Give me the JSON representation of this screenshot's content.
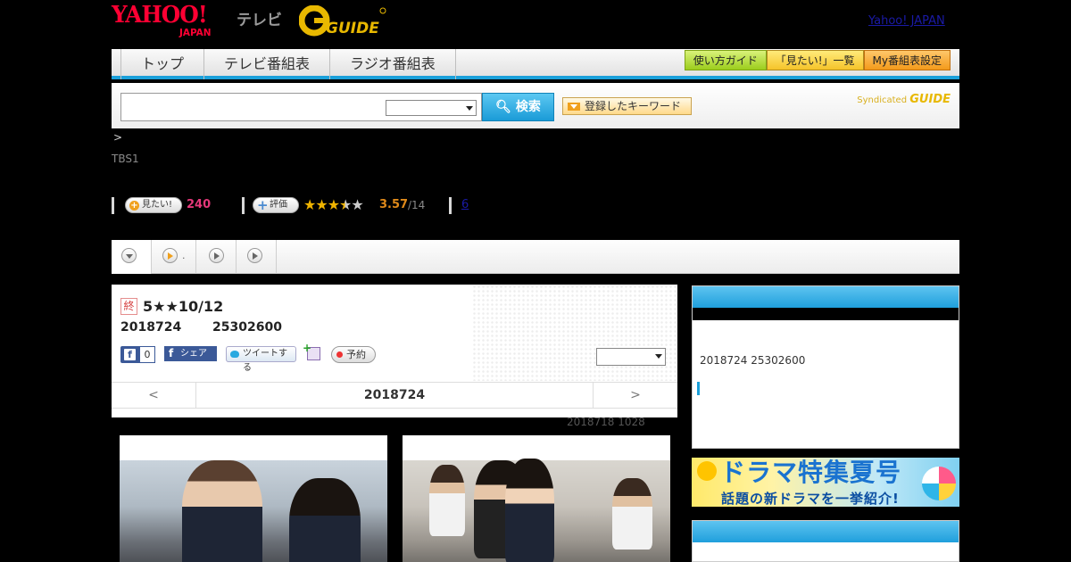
{
  "header": {
    "yahoo_logo": "YAHOO!",
    "yahoo_sub": "JAPAN",
    "tv_label": "テレビ",
    "gguide_logo": "GUIDE",
    "yahoo_japan_link": "Yahoo! JAPAN"
  },
  "nav": {
    "tabs": [
      "トップ",
      "テレビ番組表",
      "ラジオ番組表"
    ],
    "guide_button": "使い方ガイド",
    "mitai_list_button": "「見たい!」一覧",
    "my_settings_button": "My番組表設定"
  },
  "search": {
    "input_value": "",
    "button_label": "検索",
    "keyword_button": "登録したキーワード",
    "syndicated_label": "Syndicated",
    "syndicated_logo": "GUIDE"
  },
  "breadcrumb": ">",
  "channel": "TBS1",
  "stats": {
    "mitai_label": "見たい!",
    "mitai_count": "240",
    "hyouka_label": "評価",
    "rating_fraction": 0.714,
    "score": "3.57",
    "score_total": "/14",
    "reviews_link": "6"
  },
  "play_tabs": [
    ".",
    "",
    ""
  ],
  "program": {
    "end_badge": "終",
    "title": "5★★10/12",
    "date": "2018724",
    "time": "25302600",
    "fb_like_label": "f",
    "fb_like_count": "0",
    "fb_share_label": "シェア",
    "tweet_label": "ツイートする",
    "reserve_label": "予約",
    "nav_prev": "<",
    "nav_date": "2018724",
    "nav_next": ">",
    "updated": "2018718  1028"
  },
  "sidebar": {
    "info": "2018724  25302600",
    "banner_line1": "ドラマ特集夏号",
    "banner_line2": "話題の新ドラマを一挙紹介!"
  },
  "colors": {
    "accent_blue": "#1aa0da",
    "pink": "#e5387a",
    "star": "#f0b400"
  }
}
